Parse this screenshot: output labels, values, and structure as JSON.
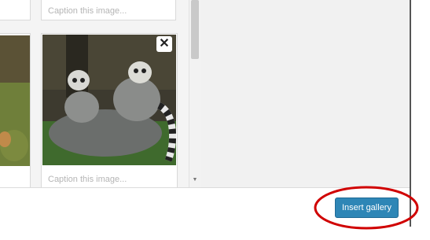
{
  "gallery": {
    "top_caption_left": "",
    "top_caption_right": "Caption this image...",
    "bottom_caption_right": "Caption this image...",
    "remove_icon": "close-icon",
    "images": [
      {
        "subject": "partial photo cropped at left edge"
      },
      {
        "subject": "ring-tailed lemurs photo"
      }
    ]
  },
  "scrollbar": {
    "down_arrow": "▼"
  },
  "footer": {
    "insert_label": "Insert gallery"
  },
  "colors": {
    "button": "#2e86b6",
    "highlight": "#d00000"
  }
}
